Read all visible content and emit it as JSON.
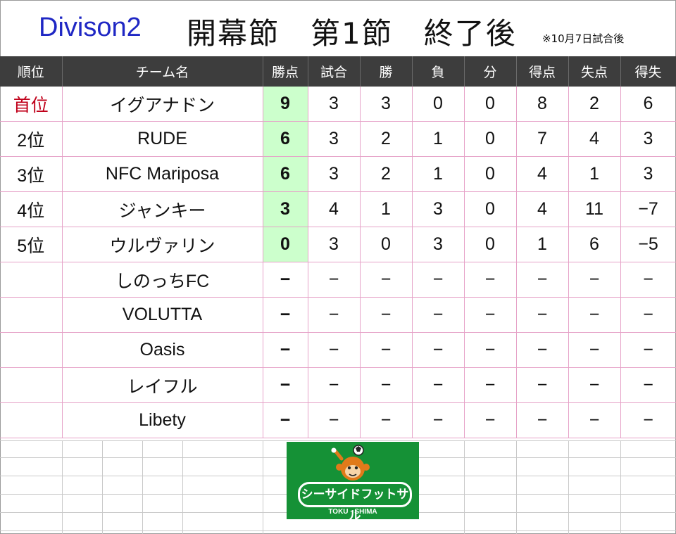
{
  "header": {
    "division": "Divison2",
    "headline": "開幕節　第1節　終了後",
    "note": "※10月7日試合後"
  },
  "columns": [
    "順位",
    "チーム名",
    "勝点",
    "試合",
    "勝",
    "負",
    "分",
    "得点",
    "失点",
    "得失"
  ],
  "rows": [
    {
      "rank": "首位",
      "team": "イグアナドン",
      "points": "9",
      "played": "3",
      "won": "3",
      "lost": "0",
      "drawn": "0",
      "gf": "8",
      "ga": "2",
      "gd": "6"
    },
    {
      "rank": "2位",
      "team": "RUDE",
      "points": "6",
      "played": "3",
      "won": "2",
      "lost": "1",
      "drawn": "0",
      "gf": "7",
      "ga": "4",
      "gd": "3"
    },
    {
      "rank": "3位",
      "team": "NFC Mariposa",
      "points": "6",
      "played": "3",
      "won": "2",
      "lost": "1",
      "drawn": "0",
      "gf": "4",
      "ga": "1",
      "gd": "3"
    },
    {
      "rank": "4位",
      "team": "ジャンキー",
      "points": "3",
      "played": "4",
      "won": "1",
      "lost": "3",
      "drawn": "0",
      "gf": "4",
      "ga": "11",
      "gd": "−7"
    },
    {
      "rank": "5位",
      "team": "ウルヴァリン",
      "points": "0",
      "played": "3",
      "won": "0",
      "lost": "3",
      "drawn": "0",
      "gf": "1",
      "ga": "6",
      "gd": "−5"
    },
    {
      "rank": "",
      "team": "しのっちFC",
      "points": "−",
      "played": "−",
      "won": "−",
      "lost": "−",
      "drawn": "−",
      "gf": "−",
      "ga": "−",
      "gd": "−"
    },
    {
      "rank": "",
      "team": "VOLUTTA",
      "points": "−",
      "played": "−",
      "won": "−",
      "lost": "−",
      "drawn": "−",
      "gf": "−",
      "ga": "−",
      "gd": "−"
    },
    {
      "rank": "",
      "team": "Oasis",
      "points": "−",
      "played": "−",
      "won": "−",
      "lost": "−",
      "drawn": "−",
      "gf": "−",
      "ga": "−",
      "gd": "−"
    },
    {
      "rank": "",
      "team": "レイフル",
      "points": "−",
      "played": "−",
      "won": "−",
      "lost": "−",
      "drawn": "−",
      "gf": "−",
      "ga": "−",
      "gd": "−"
    },
    {
      "rank": "",
      "team": "Libety",
      "points": "−",
      "played": "−",
      "won": "−",
      "lost": "−",
      "drawn": "−",
      "gf": "−",
      "ga": "−",
      "gd": "−"
    }
  ],
  "logo": {
    "main": "シーサイドフットサル",
    "sub": "TOKU · SHIMA",
    "icon": "monkey-mascot-icon"
  },
  "colors": {
    "division_text": "#1f27c4",
    "header_bg": "#3d3d3d",
    "points_highlight": "#ccffcc",
    "first_rank_text": "#c0001a",
    "row_border": "#e6a2c8",
    "logo_bg": "#159136"
  }
}
